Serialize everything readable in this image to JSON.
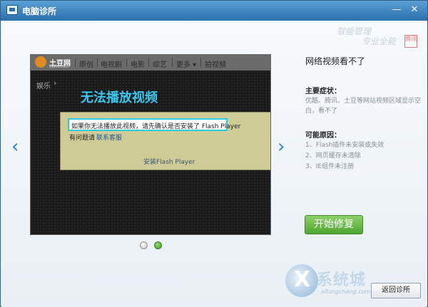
{
  "window": {
    "title": "电脑诊所",
    "min_symbol": "—",
    "close_symbol": "✕"
  },
  "watermark": {
    "line1": "智能管理",
    "line2": "专业全能",
    "badge": "腾讯"
  },
  "preview": {
    "site_name": "土豆网",
    "site_url": "tudou.com",
    "nav": [
      "原创",
      "电视剧",
      "电影",
      "综艺",
      "更多 ▾",
      "拍视频"
    ],
    "side_label": "娱乐",
    "side_chevron": "›",
    "big_title": "无法播放视频",
    "msg_line1": "如果你无法播放此视频，请先确认是否安装了 Flash Player",
    "msg_q": "有问题请",
    "msg_contact": "联系客服",
    "install_link": "安装Flash Player"
  },
  "arrows": {
    "left": "‹",
    "right": "›"
  },
  "info": {
    "title": "网络视频看不了",
    "symptoms_heading": "主要症状：",
    "symptoms_text": "优酷、腾讯、土豆等网站视频区域显示空白，看不了",
    "causes_heading": "可能原因：",
    "causes": [
      "1、Flash插件未安装或失效",
      "2、网页缓存未清除",
      "3、IE组件未注册"
    ]
  },
  "start_button": "开始修复",
  "back_button": "返回诊所",
  "brand": {
    "name": "系统城",
    "url": "xitongcheng.com"
  },
  "colors": {
    "accent_blue": "#2e7fd6",
    "start_green": "#4ea52f",
    "title_cyan": "#39c9f0"
  }
}
